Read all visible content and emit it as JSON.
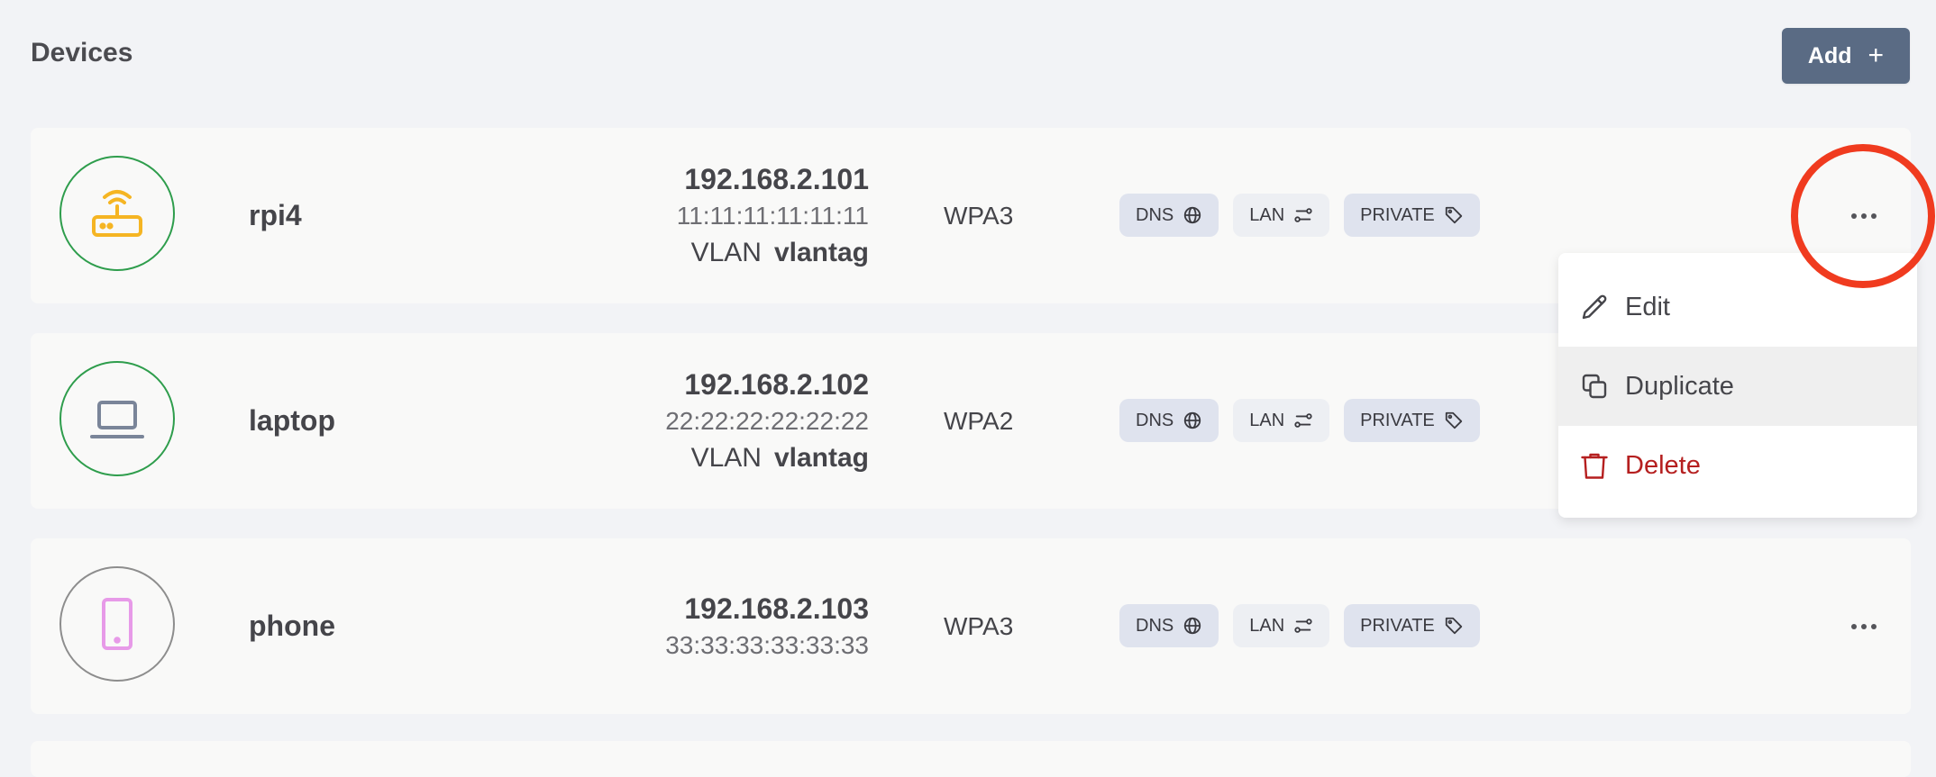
{
  "header": {
    "title": "Devices",
    "add_label": "Add",
    "add_icon": "plus-icon"
  },
  "devices": [
    {
      "name": "rpi4",
      "icon": "router-icon",
      "icon_color": "#f5b523",
      "border_color": "#2e9d4c",
      "ip": "192.168.2.101",
      "mac": "11:11:11:11:11:11",
      "vlan_label": "VLAN",
      "vlan_tag": "vlantag",
      "security": "WPA3",
      "tags": [
        "DNS",
        "LAN",
        "PRIVATE"
      ]
    },
    {
      "name": "laptop",
      "icon": "laptop-icon",
      "icon_color": "#7a8599",
      "border_color": "#2e9d4c",
      "ip": "192.168.2.102",
      "mac": "22:22:22:22:22:22",
      "vlan_label": "VLAN",
      "vlan_tag": "vlantag",
      "security": "WPA2",
      "tags": [
        "DNS",
        "LAN",
        "PRIVATE"
      ]
    },
    {
      "name": "phone",
      "icon": "phone-icon",
      "icon_color": "#e79ae8",
      "border_color": "#8d8d8d",
      "ip": "192.168.2.103",
      "mac": "33:33:33:33:33:33",
      "security": "WPA3",
      "tags": [
        "DNS",
        "LAN",
        "PRIVATE"
      ]
    }
  ],
  "context_menu": {
    "items": [
      {
        "label": "Edit",
        "icon": "pencil-icon"
      },
      {
        "label": "Duplicate",
        "icon": "copy-icon",
        "state": "hovered"
      },
      {
        "label": "Delete",
        "icon": "trash-icon",
        "color": "#b51f1f"
      }
    ]
  },
  "annotation": {
    "type": "red-circle",
    "target": "more-options-button",
    "color": "#f03b1f"
  }
}
